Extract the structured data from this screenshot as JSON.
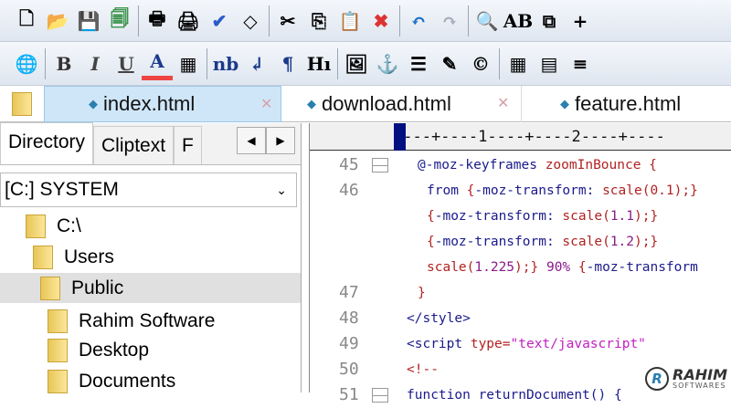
{
  "toolbar1": [
    {
      "icon": "new-file-icon",
      "glyph": "🗋"
    },
    {
      "icon": "open-folder-icon",
      "glyph": "📂"
    },
    {
      "icon": "save-icon",
      "glyph": "💾"
    },
    {
      "icon": "save-all-icon",
      "glyph": "🗐"
    },
    {
      "sep": true
    },
    {
      "icon": "print-preview-icon",
      "glyph": "🖶"
    },
    {
      "icon": "print-icon",
      "glyph": "🖨"
    },
    {
      "icon": "spellcheck-icon",
      "glyph": "✔"
    },
    {
      "icon": "code-view-icon",
      "glyph": "◇"
    },
    {
      "sep": true
    },
    {
      "icon": "cut-icon",
      "glyph": "✂"
    },
    {
      "icon": "copy-icon",
      "glyph": "⎘"
    },
    {
      "icon": "paste-icon",
      "glyph": "📋"
    },
    {
      "icon": "delete-icon",
      "glyph": "✖"
    },
    {
      "sep": true
    },
    {
      "icon": "undo-icon",
      "glyph": "↶"
    },
    {
      "icon": "redo-icon",
      "glyph": "↷"
    },
    {
      "sep": true
    },
    {
      "icon": "find-icon",
      "glyph": "🔍"
    },
    {
      "icon": "replace-icon",
      "glyph": "AB"
    },
    {
      "icon": "find-in-files-icon",
      "glyph": "⧉"
    },
    {
      "icon": "more-icon",
      "glyph": "+"
    }
  ],
  "toolbar2": [
    {
      "icon": "globe-icon",
      "glyph": "🌐"
    },
    {
      "sep": true
    },
    {
      "icon": "bold-icon",
      "glyph": "B"
    },
    {
      "icon": "italic-icon",
      "glyph": "I"
    },
    {
      "icon": "underline-icon",
      "glyph": "U"
    },
    {
      "icon": "font-color-icon",
      "glyph": "A"
    },
    {
      "icon": "color-palette-icon",
      "glyph": "▦"
    },
    {
      "sep": true
    },
    {
      "icon": "nbsp-icon",
      "glyph": "nb"
    },
    {
      "icon": "line-break-icon",
      "glyph": "↲"
    },
    {
      "icon": "paragraph-icon",
      "glyph": "¶"
    },
    {
      "icon": "heading-icon",
      "glyph": "Hı"
    },
    {
      "sep": true
    },
    {
      "icon": "image-icon",
      "glyph": "🖼"
    },
    {
      "icon": "anchor-icon",
      "glyph": "⚓"
    },
    {
      "icon": "horizontal-rule-icon",
      "glyph": "☰"
    },
    {
      "icon": "edit-icon",
      "glyph": "✎"
    },
    {
      "icon": "copyright-icon",
      "glyph": "©"
    },
    {
      "sep": true
    },
    {
      "icon": "table-icon",
      "glyph": "▦"
    },
    {
      "icon": "form-icon",
      "glyph": "▤"
    },
    {
      "icon": "list-icon",
      "glyph": "≡"
    }
  ],
  "tabs": [
    {
      "label": "index.html",
      "active": true
    },
    {
      "label": "download.html"
    },
    {
      "label": "feature.html"
    }
  ],
  "left": {
    "tabs": [
      "Directory",
      "Cliptext",
      "F"
    ],
    "drive": "[C:] SYSTEM",
    "tree": [
      {
        "label": "C:\\",
        "indent": 0
      },
      {
        "label": "Users",
        "indent": 1
      },
      {
        "label": "Public",
        "indent": 2,
        "selected": true
      },
      {
        "label": "Rahim Software",
        "indent": 3
      },
      {
        "label": "Desktop",
        "indent": 3
      },
      {
        "label": "Documents",
        "indent": 3
      }
    ]
  },
  "editor": {
    "ruler": "----+----1----+----2----+----",
    "lines": [
      {
        "num": "45",
        "fold": true,
        "indent": "  ",
        "parts": [
          [
            "kw",
            "@-moz-keyframes "
          ],
          [
            "rd",
            "zoomInBounce {"
          ]
        ]
      },
      {
        "num": "46",
        "indent": "   ",
        "parts": [
          [
            "kw",
            "from "
          ],
          [
            "rd",
            "{"
          ],
          [
            "kw",
            "-moz-transform: "
          ],
          [
            "rd",
            "scale(0.1);}"
          ]
        ]
      },
      {
        "num": "",
        "indent": "   ",
        "parts": [
          [
            "rd",
            "{"
          ],
          [
            "kw",
            "-moz-transform: "
          ],
          [
            "rd",
            "scale("
          ],
          [
            "pu",
            "1.1"
          ],
          [
            "rd",
            ");}"
          ]
        ]
      },
      {
        "num": "",
        "indent": "   ",
        "parts": [
          [
            "rd",
            "{"
          ],
          [
            "kw",
            "-moz-transform: "
          ],
          [
            "rd",
            "scale("
          ],
          [
            "pu",
            "1.2"
          ],
          [
            "rd",
            ");}"
          ]
        ]
      },
      {
        "num": "",
        "indent": "   ",
        "parts": [
          [
            "rd",
            "scale("
          ],
          [
            "pu",
            "1.225"
          ],
          [
            "rd",
            ");} "
          ],
          [
            "pu",
            "90% "
          ],
          [
            "rd",
            "{"
          ],
          [
            "kw",
            "-moz-transform"
          ]
        ]
      },
      {
        "num": "47",
        "indent": "  ",
        "parts": [
          [
            "rd",
            "}"
          ]
        ]
      },
      {
        "num": "48",
        "indent": " ",
        "parts": [
          [
            "kw",
            "</style>"
          ]
        ]
      },
      {
        "num": "49",
        "indent": " ",
        "parts": [
          [
            "kw",
            "<script "
          ],
          [
            "rd",
            "type="
          ],
          [
            "pk",
            "\"text/javascript\""
          ]
        ]
      },
      {
        "num": "50",
        "indent": " ",
        "parts": [
          [
            "rd",
            "<!--"
          ]
        ]
      },
      {
        "num": "51",
        "fold": true,
        "indent": " ",
        "parts": [
          [
            "kw",
            "function returnDocument() {"
          ]
        ]
      }
    ]
  },
  "watermark": {
    "name": "RAHIM",
    "sub": "SOFTWARES"
  }
}
